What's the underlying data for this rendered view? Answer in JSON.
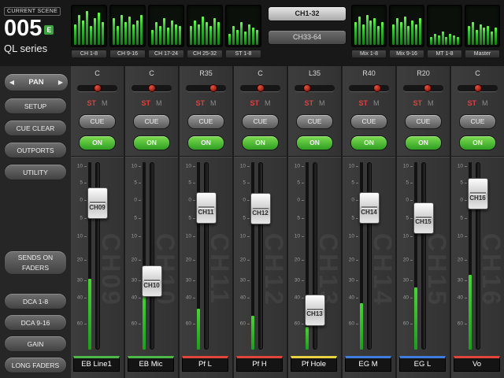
{
  "scene": {
    "title": "CURRENT SCENE",
    "number": "005",
    "edit_badge": "E",
    "series": "QL series"
  },
  "meter_bridge": {
    "left_blocks": [
      {
        "label": "CH 1-8",
        "bars": [
          0.55,
          0.8,
          0.65,
          0.9,
          0.5,
          0.7,
          0.85,
          0.6
        ]
      },
      {
        "label": "CH 9-16",
        "bars": [
          0.7,
          0.5,
          0.8,
          0.6,
          0.75,
          0.55,
          0.65,
          0.8
        ]
      },
      {
        "label": "CH 17-24",
        "bars": [
          0.4,
          0.6,
          0.5,
          0.7,
          0.45,
          0.65,
          0.55,
          0.5
        ]
      },
      {
        "label": "CH 25-32",
        "bars": [
          0.5,
          0.65,
          0.55,
          0.75,
          0.6,
          0.5,
          0.7,
          0.6
        ]
      },
      {
        "label": "ST 1-8",
        "bars": [
          0.3,
          0.5,
          0.4,
          0.6,
          0.35,
          0.55,
          0.45,
          0.4
        ]
      }
    ],
    "bank_buttons": [
      {
        "label": "CH1-32",
        "selected": true
      },
      {
        "label": "CH33-64",
        "selected": false
      }
    ],
    "right_blocks": [
      {
        "label": "Mix 1-8",
        "bars": [
          0.6,
          0.75,
          0.55,
          0.8,
          0.65,
          0.7,
          0.5,
          0.6
        ]
      },
      {
        "label": "Mix 9-16",
        "bars": [
          0.55,
          0.7,
          0.6,
          0.75,
          0.5,
          0.65,
          0.55,
          0.7
        ]
      },
      {
        "label": "MT 1-8",
        "bars": [
          0.2,
          0.3,
          0.25,
          0.35,
          0.2,
          0.3,
          0.25,
          0.2
        ]
      },
      {
        "label": "Master",
        "bars": [
          0.5,
          0.6,
          0.4,
          0.55,
          0.45,
          0.5,
          0.35,
          0.45
        ]
      }
    ]
  },
  "sidebar": {
    "pan_label": "PAN",
    "top_buttons": [
      {
        "label": "SETUP"
      },
      {
        "label": "CUE CLEAR"
      },
      {
        "label": "OUTPORTS"
      },
      {
        "label": "UTILITY"
      }
    ],
    "bottom_buttons": [
      {
        "label": "SENDS ON\nFADERS",
        "tall": true
      },
      {
        "label": "DCA 1-8"
      },
      {
        "label": "DCA 9-16"
      },
      {
        "label": "GAIN"
      },
      {
        "label": "LONG FADERS"
      }
    ]
  },
  "strip_labels": {
    "st": "ST",
    "mono": "M",
    "cue": "CUE",
    "on": "ON"
  },
  "fader_scale": {
    "labels": [
      "10",
      "5",
      "0",
      "5",
      "10",
      "20",
      "30",
      "40",
      "60"
    ],
    "positions": [
      0.03,
      0.115,
      0.205,
      0.3,
      0.395,
      0.52,
      0.63,
      0.72,
      0.855
    ]
  },
  "channels": [
    {
      "id": "CH09",
      "pan": "C",
      "pan_pos": 0.5,
      "fader_pos": 0.17,
      "meter": 0.38,
      "name": "EB Line1",
      "color": "#4cb848"
    },
    {
      "id": "CH10",
      "pan": "C",
      "pan_pos": 0.5,
      "fader_pos": 0.66,
      "meter": 0.3,
      "name": "EB Mic",
      "color": "#4cb848"
    },
    {
      "id": "CH11",
      "pan": "R35",
      "pan_pos": 0.69,
      "fader_pos": 0.2,
      "meter": 0.22,
      "name": "Pf L",
      "color": "#e0453c"
    },
    {
      "id": "CH12",
      "pan": "C",
      "pan_pos": 0.5,
      "fader_pos": 0.205,
      "meter": 0.18,
      "name": "Pf H",
      "color": "#e0453c"
    },
    {
      "id": "CH13",
      "pan": "L35",
      "pan_pos": 0.31,
      "fader_pos": 0.84,
      "meter": 0.12,
      "name": "Pf Hole",
      "color": "#e8d23f"
    },
    {
      "id": "CH14",
      "pan": "R40",
      "pan_pos": 0.71,
      "fader_pos": 0.2,
      "meter": 0.25,
      "name": "EG M",
      "color": "#3d7de0"
    },
    {
      "id": "CH15",
      "pan": "R20",
      "pan_pos": 0.61,
      "fader_pos": 0.26,
      "meter": 0.33,
      "name": "EG L",
      "color": "#3d7de0"
    },
    {
      "id": "CH16",
      "pan": "C",
      "pan_pos": 0.5,
      "fader_pos": 0.11,
      "meter": 0.4,
      "name": "Vo",
      "color": "#e0453c"
    }
  ]
}
